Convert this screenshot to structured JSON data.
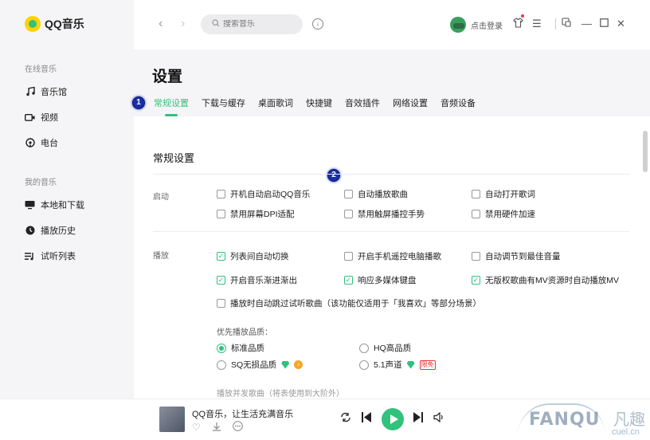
{
  "app": {
    "name": "QQ音乐"
  },
  "sidebar": {
    "group_online": "在线音乐",
    "online_items": [
      {
        "label": "音乐馆",
        "icon": "music-note-icon"
      },
      {
        "label": "视频",
        "icon": "video-icon"
      },
      {
        "label": "电台",
        "icon": "radio-icon"
      }
    ],
    "group_mine": "我的音乐",
    "mine_items": [
      {
        "label": "本地和下载",
        "icon": "monitor-icon"
      },
      {
        "label": "播放历史",
        "icon": "clock-icon"
      },
      {
        "label": "试听列表",
        "icon": "playlist-icon"
      }
    ]
  },
  "topbar": {
    "search_placeholder": "搜索音乐",
    "login_label": "点击登录"
  },
  "settings": {
    "title": "设置",
    "tabs": [
      "常规设置",
      "下载与缓存",
      "桌面歌词",
      "快捷键",
      "音效插件",
      "网络设置",
      "音频设备"
    ],
    "active_tab": "常规设置",
    "section_title": "常规设置",
    "startup": {
      "label": "启动",
      "options": [
        {
          "label": "开机自动启动QQ音乐",
          "checked": false
        },
        {
          "label": "自动播放歌曲",
          "checked": false
        },
        {
          "label": "自动打开歌词",
          "checked": false
        },
        {
          "label": "禁用屏幕DPI适配",
          "checked": false
        },
        {
          "label": "禁用触屏播控手势",
          "checked": false
        },
        {
          "label": "禁用硬件加速",
          "checked": false
        }
      ]
    },
    "playback": {
      "label": "播放",
      "options": [
        {
          "label": "列表间自动切换",
          "checked": true
        },
        {
          "label": "开启手机遥控电脑播歌",
          "checked": false
        },
        {
          "label": "自动调节到最佳音量",
          "checked": false
        },
        {
          "label": "开启音乐渐进渐出",
          "checked": true
        },
        {
          "label": "响应多媒体键盘",
          "checked": true
        },
        {
          "label": "无版权歌曲有MV资源时自动播放MV",
          "checked": true
        },
        {
          "label": "播放时自动跳过试听歌曲（该功能仅适用于「我喜欢」等部分场景）",
          "checked": false
        }
      ],
      "quality_label": "优先播放品质：",
      "quality_options": [
        {
          "label": "标准品质",
          "selected": true
        },
        {
          "label": "HQ高品质",
          "selected": false
        },
        {
          "label": "SQ无损品质",
          "selected": false
        },
        {
          "label": "5.1声道",
          "selected": false,
          "tag": "限免"
        }
      ],
      "cut_off_text": "播放并发歌曲（将表使用到大阶外）"
    }
  },
  "annotations": [
    "1",
    "2"
  ],
  "player": {
    "song_title": "QQ音乐，让生活充满音乐"
  },
  "watermark": {
    "text": "FANQU",
    "cn": "凡趣",
    "sub": "cuel.cn"
  },
  "colors": {
    "accent": "#31c27c",
    "sidebar_bg": "#f5f5f7",
    "badge": "#1a2ea8"
  }
}
